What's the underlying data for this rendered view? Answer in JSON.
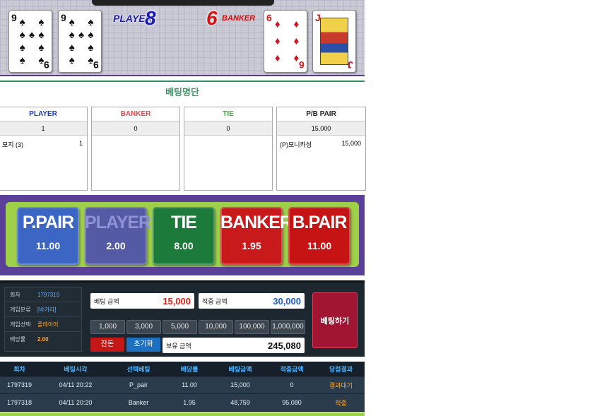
{
  "cards": {
    "player": [
      {
        "rank": "9",
        "suit": "♠"
      },
      {
        "rank": "9",
        "suit": "♠"
      }
    ],
    "banker": [
      {
        "rank": "6",
        "suit": "♦"
      },
      {
        "rank": "J",
        "suit": "♦"
      }
    ],
    "player_label": "PLAYER",
    "player_score": "8",
    "banker_label": "BANKER",
    "banker_score": "6"
  },
  "bet_list": {
    "title": "베팅명단",
    "columns": [
      {
        "header": "PLAYER",
        "total": "1",
        "rows": [
          {
            "name": "모지 (3)",
            "amount": "1"
          }
        ]
      },
      {
        "header": "BANKER",
        "total": "0",
        "rows": []
      },
      {
        "header": "TIE",
        "total": "0",
        "rows": []
      },
      {
        "header": "P/B PAIR",
        "total": "15,000",
        "rows": [
          {
            "name": "(P)모니카성",
            "amount": "15,000"
          }
        ]
      }
    ]
  },
  "board": [
    {
      "name": "P.PAIR",
      "odds": "11.00"
    },
    {
      "name": "PLAYER",
      "odds": "2.00"
    },
    {
      "name": "TIE",
      "odds": "8.00"
    },
    {
      "name": "BANKER",
      "odds": "1.95"
    },
    {
      "name": "B.PAIR",
      "odds": "11.00"
    }
  ],
  "info": {
    "round_label": "회차",
    "round": "1797319",
    "type_label": "게임분류",
    "type": "[바카라]",
    "select_label": "게임선택",
    "select": "플레이어",
    "odds_label": "배당률",
    "odds": "2.00"
  },
  "controls": {
    "bet_amount_label": "베팅 금액",
    "bet_amount": "15,000",
    "win_amount_label": "적중 금액",
    "win_amount": "30,000",
    "chips": [
      "1,000",
      "3,000",
      "5,000",
      "10,000",
      "100,000",
      "1,000,000"
    ],
    "change_label": "잔돈",
    "reset_label": "초기화",
    "balance_label": "보유 금액",
    "balance": "245,080",
    "place_bet_label": "베팅하기"
  },
  "history": {
    "headers": [
      "회차",
      "베팅시각",
      "선택베팅",
      "배당률",
      "베팅금액",
      "적중금액",
      "당첨결과"
    ],
    "rows": [
      [
        "1797319",
        "04/11 20:22",
        "P_pair",
        "11.00",
        "15,000",
        "0",
        "결과대기"
      ],
      [
        "1797318",
        "04/11 20:20",
        "Banker",
        "1.95",
        "48,759",
        "95,080",
        "적중"
      ]
    ]
  },
  "colors": {
    "player_blue": "#1a1ab8",
    "banker_red": "#d41010",
    "tie_green": "#1c7a3a",
    "board_purple": "#5a4098",
    "board_green": "#9fd04a",
    "accent_orange": "#ffa52b",
    "accent_blue": "#4fb3ff"
  }
}
